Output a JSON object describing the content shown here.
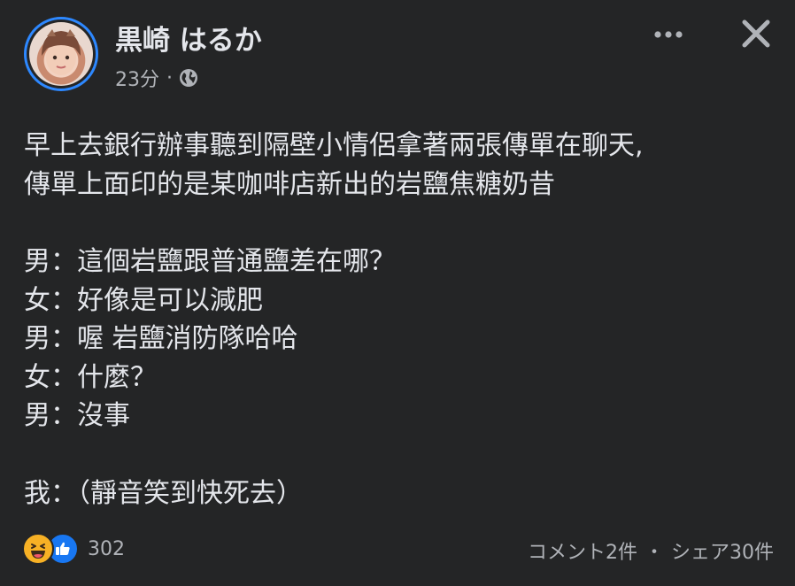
{
  "author": {
    "name": "黒崎 はるか",
    "time": "23分",
    "separator": "·",
    "privacy_icon": "globe-icon"
  },
  "header_actions": {
    "more_icon": "more-options-icon",
    "close_icon": "close-icon"
  },
  "post": {
    "lines_intro": [
      "早上去銀行辦事聽到隔壁小情侶拿著兩張傳單在聊天,",
      "傳單上面印的是某咖啡店新出的岩鹽焦糖奶昔"
    ],
    "dialogue": [
      "男：這個岩鹽跟普通鹽差在哪？",
      "女：好像是可以減肥",
      "男：喔 岩鹽消防隊哈哈",
      "女：什麼？",
      "男：沒事"
    ],
    "closing": "我：（靜音笑到快死去）"
  },
  "footer": {
    "reaction_icons": [
      "haha-reaction-icon",
      "like-reaction-icon"
    ],
    "reaction_count": "302",
    "comments": "コメント2件",
    "separator": "・",
    "shares": "シェア30件"
  },
  "colors": {
    "background": "#242526",
    "text_primary": "#e4e6eb",
    "text_secondary": "#b0b3b8",
    "avatar_ring": "#2d88ff",
    "like_blue": "#1877f2",
    "haha_yellow": "#f7b125"
  }
}
